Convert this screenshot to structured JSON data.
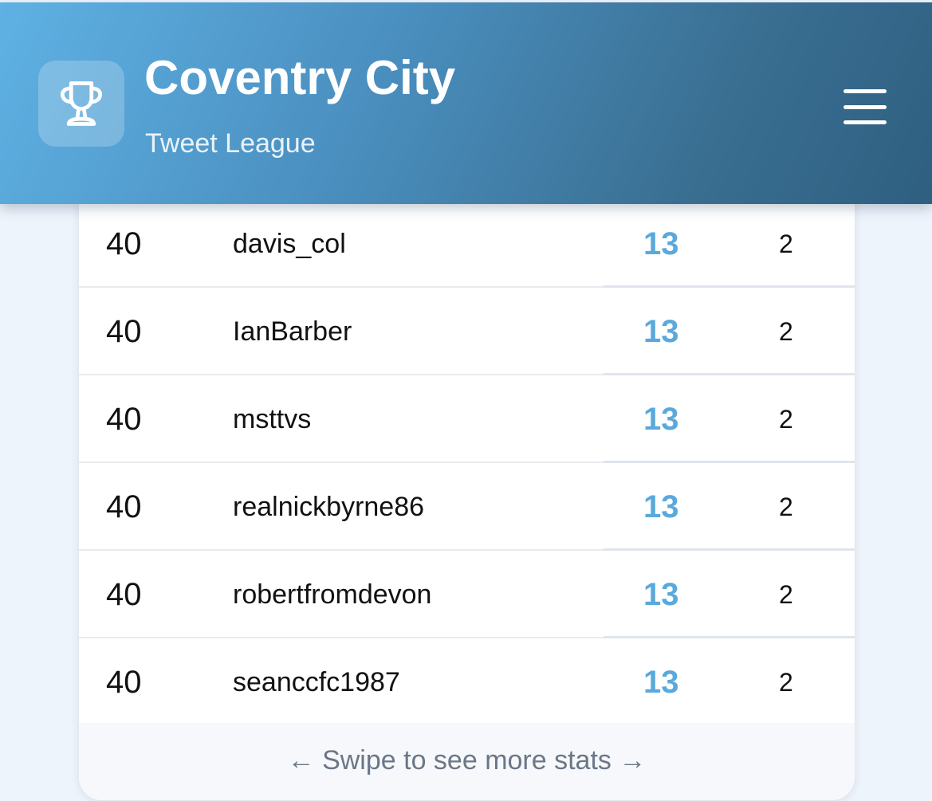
{
  "header": {
    "title": "Coventry City",
    "subtitle": "Tweet League"
  },
  "icons": {
    "logo": "trophy-icon",
    "menu": "hamburger-menu-icon"
  },
  "colors": {
    "header_gradient_start": "#5fb1e4",
    "header_gradient_end": "#2e5f80",
    "points_accent": "#5aa9dc",
    "page_background": "#eef4fb"
  },
  "leaderboard": {
    "rows": [
      {
        "rank": "40",
        "user": "davis_col",
        "points": "13",
        "stat": "2"
      },
      {
        "rank": "40",
        "user": "IanBarber",
        "points": "13",
        "stat": "2"
      },
      {
        "rank": "40",
        "user": "msttvs",
        "points": "13",
        "stat": "2"
      },
      {
        "rank": "40",
        "user": "realnickbyrne86",
        "points": "13",
        "stat": "2"
      },
      {
        "rank": "40",
        "user": "robertfromdevon",
        "points": "13",
        "stat": "2"
      },
      {
        "rank": "40",
        "user": "seanccfc1987",
        "points": "13",
        "stat": "2"
      }
    ],
    "footer_hint": "← Swipe to see more stats →"
  }
}
